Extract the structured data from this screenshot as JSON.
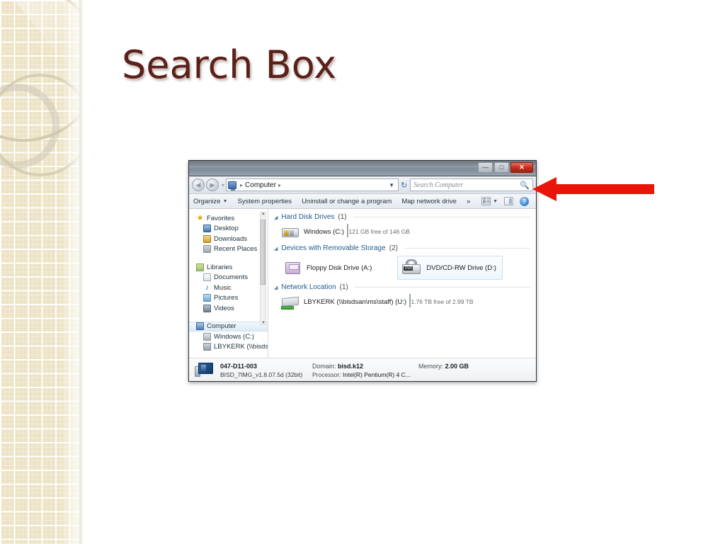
{
  "slide": {
    "title": "Search Box",
    "title_color": "#5b2018"
  },
  "window": {
    "title": "",
    "buttons": {
      "minimize": "—",
      "maximize": "□",
      "close": "✕"
    },
    "address": {
      "back_glyph": "◀",
      "forward_glyph": "▶",
      "separator": "▾",
      "icon_name": "computer-icon",
      "crumb": "Computer",
      "crumb_chevron": "▸",
      "leading_chevron": "▸",
      "dropdown_glyph": "▼",
      "refresh_glyph": "↻"
    },
    "search": {
      "placeholder": "Search Computer",
      "icon": "🔍",
      "value": ""
    },
    "toolbar": {
      "items": [
        {
          "label": "Organize",
          "caret": "▼"
        },
        {
          "label": "System properties",
          "caret": ""
        },
        {
          "label": "Uninstall or change a program",
          "caret": ""
        },
        {
          "label": "Map network drive",
          "caret": ""
        },
        {
          "label": "»",
          "caret": ""
        }
      ],
      "view_caret": "▼",
      "help_glyph": "?"
    },
    "navpane": {
      "groups": [
        {
          "header": {
            "label": "Favorites",
            "icon": "star-icon"
          },
          "items": [
            {
              "label": "Desktop",
              "icon": "desktop-icon"
            },
            {
              "label": "Downloads",
              "icon": "downloads-icon"
            },
            {
              "label": "Recent Places",
              "icon": "recent-places-icon"
            }
          ]
        },
        {
          "header": {
            "label": "Libraries",
            "icon": "libraries-icon"
          },
          "items": [
            {
              "label": "Documents",
              "icon": "documents-icon"
            },
            {
              "label": "Music",
              "icon": "music-icon"
            },
            {
              "label": "Pictures",
              "icon": "pictures-icon"
            },
            {
              "label": "Videos",
              "icon": "videos-icon"
            }
          ]
        },
        {
          "header": {
            "label": "Computer",
            "icon": "computer-icon",
            "selected": true
          },
          "items": [
            {
              "label": "Windows (C:)",
              "icon": "hard-drive-icon"
            },
            {
              "label": "LBYKERK (\\\\bisds",
              "icon": "network-drive-icon",
              "caret": "▾"
            }
          ]
        }
      ],
      "scroll_up_glyph": "▲",
      "scroll_down_glyph": "▼"
    },
    "content": {
      "groups": [
        {
          "title": "Hard Disk Drives",
          "count": "(1)",
          "caret": "◢",
          "drives": [
            {
              "name": "Windows (C:)",
              "capacity_text": "121 GB free of 146 GB",
              "fill_percent": 17,
              "icon": "hard-drive-icon"
            }
          ]
        },
        {
          "title": "Devices with Removable Storage",
          "count": "(2)",
          "caret": "◢",
          "tiles": [
            {
              "label": "Floppy Disk Drive (A:)",
              "icon": "floppy-disk-icon",
              "selected": false
            },
            {
              "label": "DVD/CD-RW Drive (D:)",
              "icon": "dvd-drive-icon",
              "selected": true,
              "disc_text": "DVD"
            }
          ]
        },
        {
          "title": "Network Location",
          "count": "(1)",
          "caret": "◢",
          "drives": [
            {
              "name": "LBYKERK (\\\\bisdsan\\ms\\staff) (U:)",
              "capacity_text": "1.76 TB free of 2.99 TB",
              "fill_percent": 41,
              "icon": "network-drive-icon"
            }
          ]
        }
      ]
    },
    "statusbar": {
      "computer_name": "047-D11-003",
      "image_version": "BISD_7IMG_v1.8.07.5d  (32bit)",
      "domain_label": "Domain:",
      "domain_value": "bisd.k12",
      "processor_label": "Processor:",
      "processor_value": "Intel(R) Pentium(R) 4 C...",
      "memory_label": "Memory:",
      "memory_value": "2.00 GB",
      "icon": "computer-icon"
    }
  },
  "annotation": {
    "arrow_color": "#e81508",
    "arrow_direction": "left",
    "points_at": "Search Computer box"
  }
}
